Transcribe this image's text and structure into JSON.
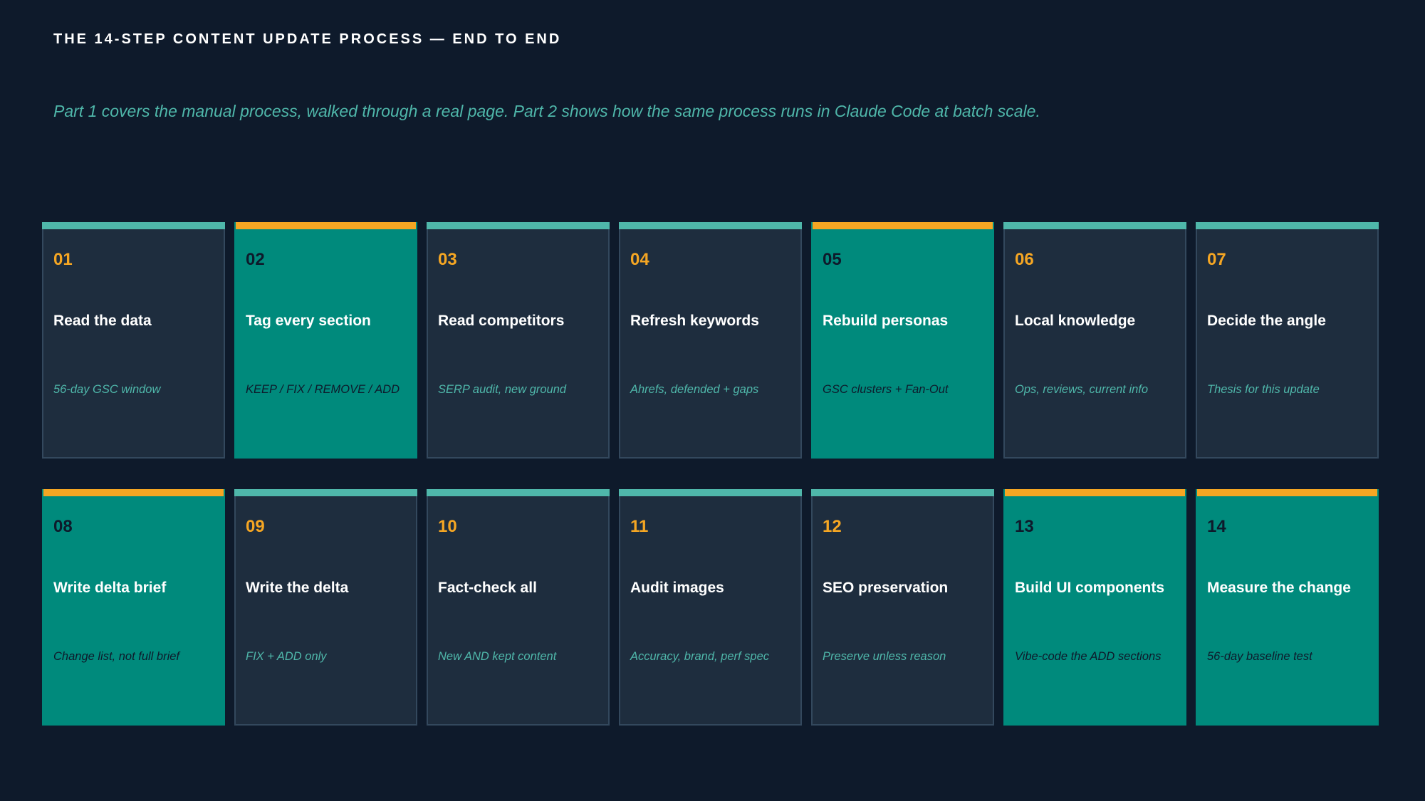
{
  "header": {
    "title": "THE 14-STEP CONTENT UPDATE PROCESS — END TO END",
    "subtitle": "Part 1 covers the manual process, walked through a real page. Part 2 shows how the same process runs in Claude Code at batch scale."
  },
  "colors": {
    "background": "#0e1a2b",
    "card_dark": "#1e2d3e",
    "card_teal": "#008a7c",
    "accent_teal": "#4fb7aa",
    "accent_orange": "#f5a623"
  },
  "steps": [
    {
      "num": "01",
      "title": "Read the data",
      "desc": "56-day GSC window",
      "style": "dark",
      "bar": "teal"
    },
    {
      "num": "02",
      "title": "Tag every section",
      "desc": "KEEP / FIX / REMOVE / ADD",
      "style": "teal",
      "bar": "orange"
    },
    {
      "num": "03",
      "title": "Read competitors",
      "desc": "SERP audit, new ground",
      "style": "dark",
      "bar": "teal"
    },
    {
      "num": "04",
      "title": "Refresh keywords",
      "desc": "Ahrefs, defended + gaps",
      "style": "dark",
      "bar": "teal"
    },
    {
      "num": "05",
      "title": "Rebuild personas",
      "desc": "GSC clusters + Fan-Out",
      "style": "teal",
      "bar": "orange"
    },
    {
      "num": "06",
      "title": "Local knowledge",
      "desc": "Ops, reviews, current info",
      "style": "dark",
      "bar": "teal"
    },
    {
      "num": "07",
      "title": "Decide the angle",
      "desc": "Thesis for this update",
      "style": "dark",
      "bar": "teal"
    },
    {
      "num": "08",
      "title": "Write delta brief",
      "desc": "Change list, not full brief",
      "style": "teal",
      "bar": "orange"
    },
    {
      "num": "09",
      "title": "Write the delta",
      "desc": "FIX + ADD only",
      "style": "dark",
      "bar": "teal"
    },
    {
      "num": "10",
      "title": "Fact-check all",
      "desc": "New AND kept content",
      "style": "dark",
      "bar": "teal"
    },
    {
      "num": "11",
      "title": "Audit images",
      "desc": "Accuracy, brand, perf spec",
      "style": "dark",
      "bar": "teal"
    },
    {
      "num": "12",
      "title": "SEO preservation",
      "desc": "Preserve unless reason",
      "style": "dark",
      "bar": "teal"
    },
    {
      "num": "13",
      "title": "Build UI components",
      "desc": "Vibe-code the ADD sections",
      "style": "teal",
      "bar": "orange"
    },
    {
      "num": "14",
      "title": "Measure the change",
      "desc": "56-day baseline test",
      "style": "teal",
      "bar": "orange"
    }
  ]
}
